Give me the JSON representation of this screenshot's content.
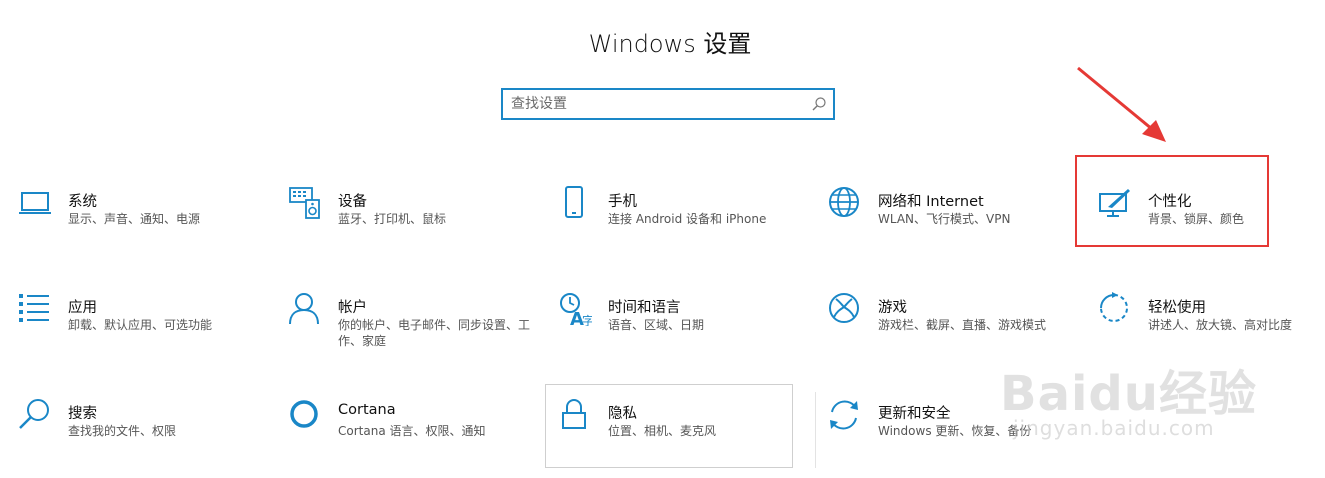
{
  "window": {
    "title": "Windows 设置"
  },
  "search": {
    "placeholder": "查找设置",
    "icon": "search-icon"
  },
  "accent": "#1a87c7",
  "tiles": [
    {
      "title": "系统",
      "desc": "显示、声音、通知、电源",
      "icon": "laptop-icon"
    },
    {
      "title": "设备",
      "desc": "蓝牙、打印机、鼠标",
      "icon": "keyboard-speaker-icon"
    },
    {
      "title": "手机",
      "desc": "连接 Android 设备和 iPhone",
      "icon": "phone-icon"
    },
    {
      "title": "网络和 Internet",
      "desc": "WLAN、飞行模式、VPN",
      "icon": "globe-icon"
    },
    {
      "title": "个性化",
      "desc": "背景、锁屏、颜色",
      "icon": "paint-screen-icon"
    },
    {
      "title": "应用",
      "desc": "卸载、默认应用、可选功能",
      "icon": "list-icon"
    },
    {
      "title": "帐户",
      "desc": "你的帐户、电子邮件、同步设置、工作、家庭",
      "icon": "person-icon"
    },
    {
      "title": "时间和语言",
      "desc": "语音、区域、日期",
      "icon": "time-language-icon"
    },
    {
      "title": "游戏",
      "desc": "游戏栏、截屏、直播、游戏模式",
      "icon": "xbox-icon"
    },
    {
      "title": "轻松使用",
      "desc": "讲述人、放大镜、高对比度",
      "icon": "ease-of-access-icon"
    },
    {
      "title": "搜索",
      "desc": "查找我的文件、权限",
      "icon": "magnifier-icon"
    },
    {
      "title": "Cortana",
      "desc": "Cortana 语言、权限、通知",
      "icon": "cortana-ring-icon"
    },
    {
      "title": "隐私",
      "desc": "位置、相机、麦克风",
      "icon": "lock-icon"
    },
    {
      "title": "更新和安全",
      "desc": "Windows 更新、恢复、备份",
      "icon": "refresh-icon"
    }
  ],
  "annotation": {
    "highlight_color": "#e53935"
  },
  "watermark": {
    "brand": "Baidu经验",
    "url": "jingyan.baidu.com"
  }
}
